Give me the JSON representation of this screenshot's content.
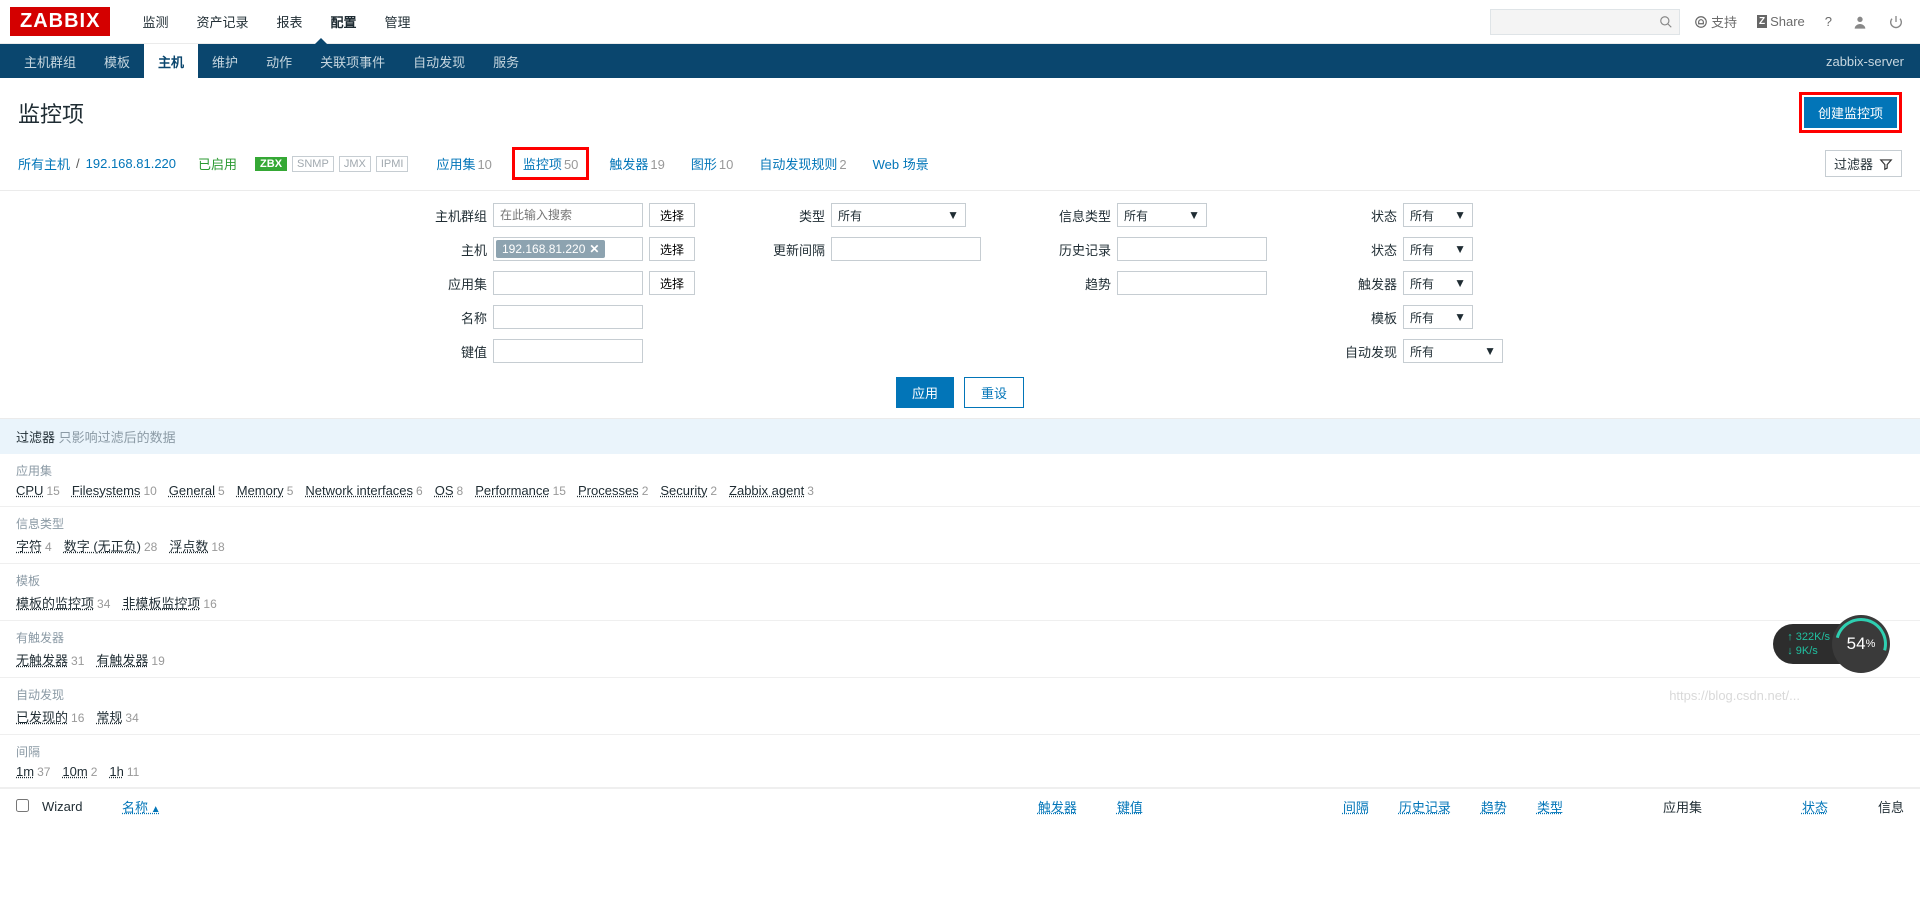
{
  "logo": "ZABBIX",
  "top_nav": [
    "监测",
    "资产记录",
    "报表",
    "配置",
    "管理"
  ],
  "top_nav_active": 3,
  "top_support": "支持",
  "top_share": "Share",
  "sub_nav": [
    "主机群组",
    "模板",
    "主机",
    "维护",
    "动作",
    "关联项事件",
    "自动发现",
    "服务"
  ],
  "sub_nav_active": 2,
  "sub_right": "zabbix-server",
  "page_title": "监控项",
  "create_button": "创建监控项",
  "crumb": {
    "all_hosts": "所有主机",
    "ip": "192.168.81.220",
    "enabled": "已启用"
  },
  "badges": {
    "zbx": "ZBX",
    "snmp": "SNMP",
    "jmx": "JMX",
    "ipmi": "IPMI"
  },
  "tabs": [
    {
      "label": "应用集",
      "count": "10"
    },
    {
      "label": "监控项",
      "count": "50"
    },
    {
      "label": "触发器",
      "count": "19"
    },
    {
      "label": "图形",
      "count": "10"
    },
    {
      "label": "自动发现规则",
      "count": "2"
    },
    {
      "label": "Web 场景",
      "count": ""
    }
  ],
  "filter_toggle": "过滤器",
  "filter": {
    "labels": {
      "host_group": "主机群组",
      "host": "主机",
      "appset": "应用集",
      "name": "名称",
      "key": "键值",
      "type": "类型",
      "update": "更新间隔",
      "history": "历史记录",
      "trend": "趋势",
      "info_type": "信息类型",
      "status": "状态",
      "state": "状态",
      "trigger": "触发器",
      "template": "模板",
      "discovery": "自动发现"
    },
    "host_group_ph": "在此输入搜索",
    "host_chip": "192.168.81.220",
    "select": "选择",
    "all": "所有",
    "apply": "应用",
    "reset": "重设"
  },
  "subfilter_head": {
    "label": "过滤器",
    "hint": "只影响过滤后的数据"
  },
  "subfilter_blocks": [
    {
      "title": "应用集",
      "items": [
        {
          "label": "CPU",
          "cnt": "15"
        },
        {
          "label": "Filesystems",
          "cnt": "10"
        },
        {
          "label": "General",
          "cnt": "5"
        },
        {
          "label": "Memory",
          "cnt": "5"
        },
        {
          "label": "Network interfaces",
          "cnt": "6"
        },
        {
          "label": "OS",
          "cnt": "8"
        },
        {
          "label": "Performance",
          "cnt": "15"
        },
        {
          "label": "Processes",
          "cnt": "2"
        },
        {
          "label": "Security",
          "cnt": "2"
        },
        {
          "label": "Zabbix agent",
          "cnt": "3"
        }
      ]
    },
    {
      "title": "信息类型",
      "items": [
        {
          "label": "字符",
          "cnt": "4"
        },
        {
          "label": "数字 (无正负)",
          "cnt": "28"
        },
        {
          "label": "浮点数",
          "cnt": "18"
        }
      ]
    },
    {
      "title": "模板",
      "items": [
        {
          "label": "模板的监控项",
          "cnt": "34"
        },
        {
          "label": "非模板监控项",
          "cnt": "16"
        }
      ]
    },
    {
      "title": "有触发器",
      "items": [
        {
          "label": "无触发器",
          "cnt": "31"
        },
        {
          "label": "有触发器",
          "cnt": "19"
        }
      ]
    },
    {
      "title": "自动发现",
      "items": [
        {
          "label": "已发现的",
          "cnt": "16"
        },
        {
          "label": "常规",
          "cnt": "34"
        }
      ]
    },
    {
      "title": "间隔",
      "items": [
        {
          "label": "1m",
          "cnt": "37"
        },
        {
          "label": "10m",
          "cnt": "2"
        },
        {
          "label": "1h",
          "cnt": "11"
        }
      ]
    }
  ],
  "table_headers": {
    "wizard": "Wizard",
    "name": "名称",
    "trigger": "触发器",
    "key": "键值",
    "interval": "间隔",
    "history": "历史记录",
    "trend": "趋势",
    "type": "类型",
    "appset": "应用集",
    "status": "状态",
    "info": "信息"
  },
  "widget": {
    "up": "322K/s",
    "down": "9K/s",
    "pct": "54"
  },
  "watermark": "https://blog.csdn.net/..."
}
